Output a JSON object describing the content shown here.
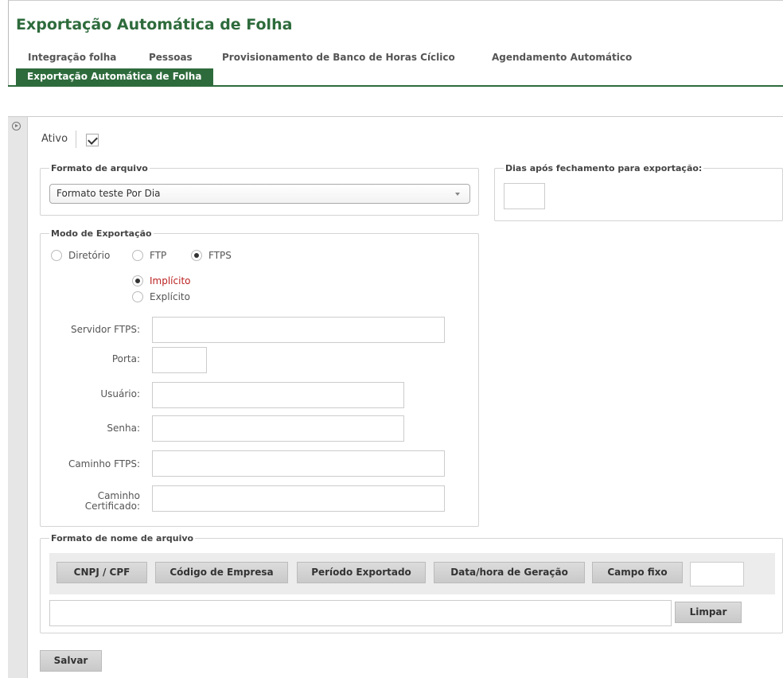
{
  "page": {
    "title": "Exportação Automática de Folha"
  },
  "tabs": [
    {
      "label": "Integração folha"
    },
    {
      "label": "Pessoas"
    },
    {
      "label": "Provisionamento de Banco de Horas Cíclico"
    },
    {
      "label": "Agendamento Automático"
    },
    {
      "label": "Exportação Automática de Folha",
      "active": true
    }
  ],
  "form": {
    "ativo": {
      "label": "Ativo",
      "checked": true
    },
    "file_format": {
      "legend": "Formato de arquivo",
      "selected": "Formato teste Por Dia"
    },
    "days_after": {
      "legend": "Dias após fechamento para exportação:",
      "value": ""
    },
    "export_mode": {
      "legend": "Modo de Exportação",
      "options": [
        "Diretório",
        "FTP",
        "FTPS"
      ],
      "selected": "FTPS",
      "ftps_modes": [
        "Implícito",
        "Explícito"
      ],
      "ftps_selected": "Implícito",
      "fields": {
        "server": {
          "label": "Servidor FTPS:",
          "value": ""
        },
        "port": {
          "label": "Porta:",
          "value": ""
        },
        "user": {
          "label": "Usuário:",
          "value": ""
        },
        "password": {
          "label": "Senha:",
          "value": ""
        },
        "path": {
          "label": "Caminho FTPS:",
          "value": ""
        },
        "cert_path": {
          "label": "Caminho Certificado:",
          "value": ""
        }
      }
    },
    "filename_format": {
      "legend": "Formato de nome de arquivo",
      "buttons": [
        "CNPJ / CPF",
        "Código de Empresa",
        "Período Exportado",
        "Data/hora de Geração",
        "Campo fixo"
      ],
      "clear_label": "Limpar",
      "value": ""
    },
    "save_label": "Salvar"
  },
  "colors": {
    "accent": "#2e6b3c",
    "alert": "#b22222"
  }
}
